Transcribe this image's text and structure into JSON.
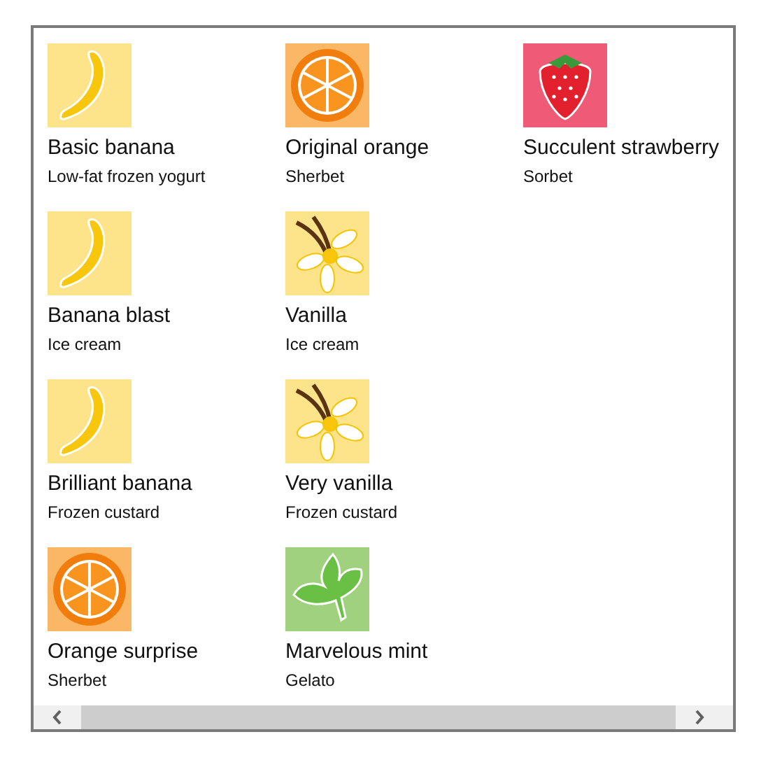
{
  "items": [
    {
      "title": "Basic banana",
      "subtitle": "Low-fat frozen yogurt",
      "kind": "banana"
    },
    {
      "title": "Banana blast",
      "subtitle": "Ice cream",
      "kind": "banana"
    },
    {
      "title": "Brilliant banana",
      "subtitle": "Frozen custard",
      "kind": "banana"
    },
    {
      "title": "Orange surprise",
      "subtitle": "Sherbet",
      "kind": "orange"
    },
    {
      "title": "Original orange",
      "subtitle": "Sherbet",
      "kind": "orange"
    },
    {
      "title": "Vanilla",
      "subtitle": "Ice cream",
      "kind": "vanilla"
    },
    {
      "title": "Very vanilla",
      "subtitle": "Frozen custard",
      "kind": "vanilla"
    },
    {
      "title": "Marvelous mint",
      "subtitle": "Gelato",
      "kind": "mint"
    },
    {
      "title": "Succulent strawberry",
      "subtitle": "Sorbet",
      "kind": "strawberry"
    }
  ]
}
